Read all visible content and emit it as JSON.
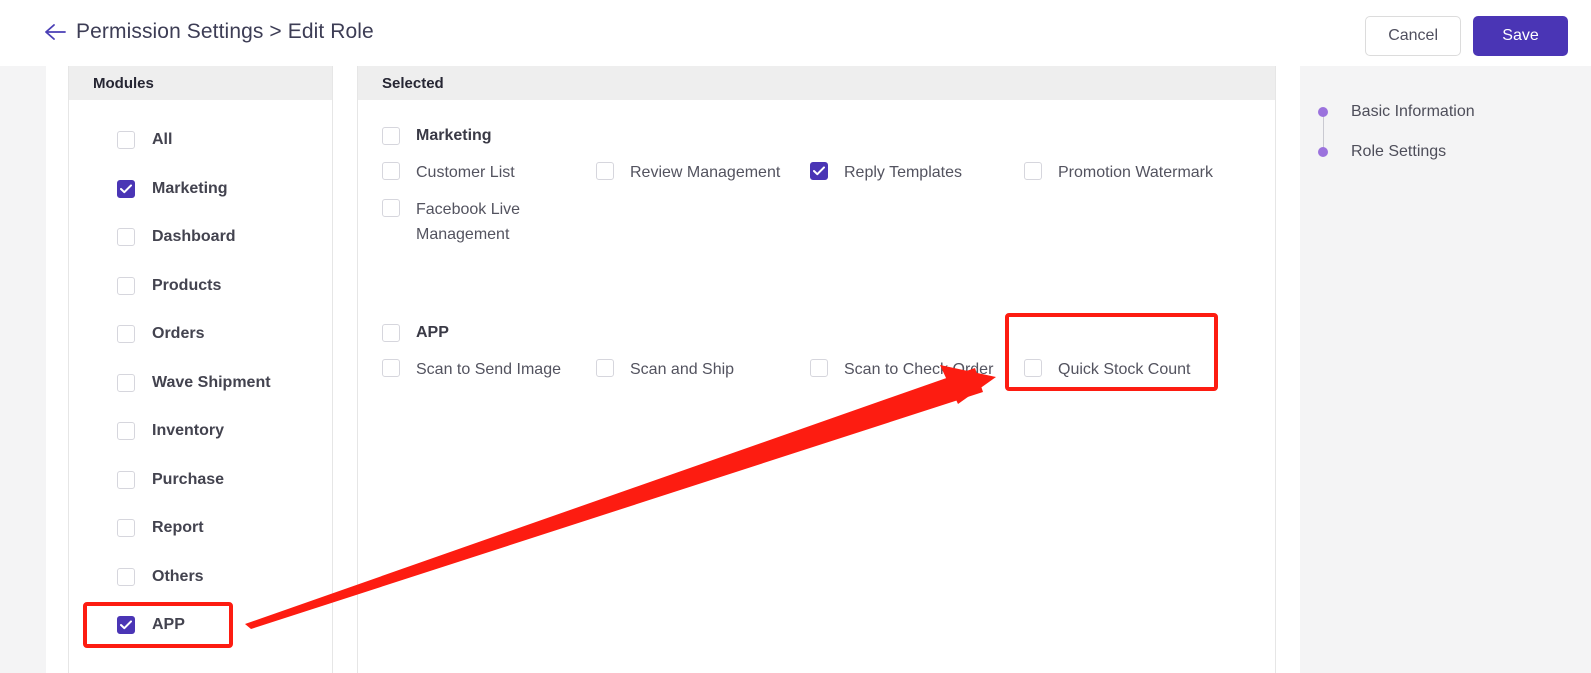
{
  "header": {
    "back_icon": "arrow-left-icon",
    "breadcrumb": "Permission Settings > Edit Role",
    "cancel_label": "Cancel",
    "save_label": "Save"
  },
  "modules_panel": {
    "title": "Modules",
    "items": [
      {
        "label": "All",
        "checked": false
      },
      {
        "label": "Marketing",
        "checked": true
      },
      {
        "label": "Dashboard",
        "checked": false
      },
      {
        "label": "Products",
        "checked": false
      },
      {
        "label": "Orders",
        "checked": false
      },
      {
        "label": "Wave Shipment",
        "checked": false
      },
      {
        "label": "Inventory",
        "checked": false
      },
      {
        "label": "Purchase",
        "checked": false
      },
      {
        "label": "Report",
        "checked": false
      },
      {
        "label": "Others",
        "checked": false
      },
      {
        "label": "APP",
        "checked": true
      }
    ]
  },
  "selected_panel": {
    "title": "Selected",
    "groups": [
      {
        "title": "Marketing",
        "checked": false,
        "permissions": [
          {
            "label": "Customer List",
            "checked": false
          },
          {
            "label": "Review Management",
            "checked": false
          },
          {
            "label": "Reply Templates",
            "checked": true
          },
          {
            "label": "Promotion Watermark",
            "checked": false
          },
          {
            "label": "Facebook Live Management",
            "checked": false
          }
        ]
      },
      {
        "title": "APP",
        "checked": false,
        "permissions": [
          {
            "label": "Scan to Send Image",
            "checked": false
          },
          {
            "label": "Scan and Ship",
            "checked": false
          },
          {
            "label": "Scan to Check Order",
            "checked": false
          },
          {
            "label": "Quick Stock Count",
            "checked": false
          }
        ]
      }
    ]
  },
  "right_nav": {
    "items": [
      {
        "label": "Basic Information"
      },
      {
        "label": "Role Settings"
      }
    ]
  },
  "annotations": {
    "highlight_color": "#fd1c11",
    "boxes": [
      {
        "name": "app-module-highlight",
        "target": "APP"
      },
      {
        "name": "quick-stock-count-highlight",
        "target": "Quick Stock Count"
      }
    ],
    "arrow": {
      "name": "pointer-arrow",
      "from": "APP",
      "to": "Quick Stock Count"
    }
  },
  "colors": {
    "accent": "#4a35b5",
    "panel_header_bg": "#eeeeee",
    "page_bg": "#f4f4f5",
    "nav_dot": "#9b72dd"
  }
}
